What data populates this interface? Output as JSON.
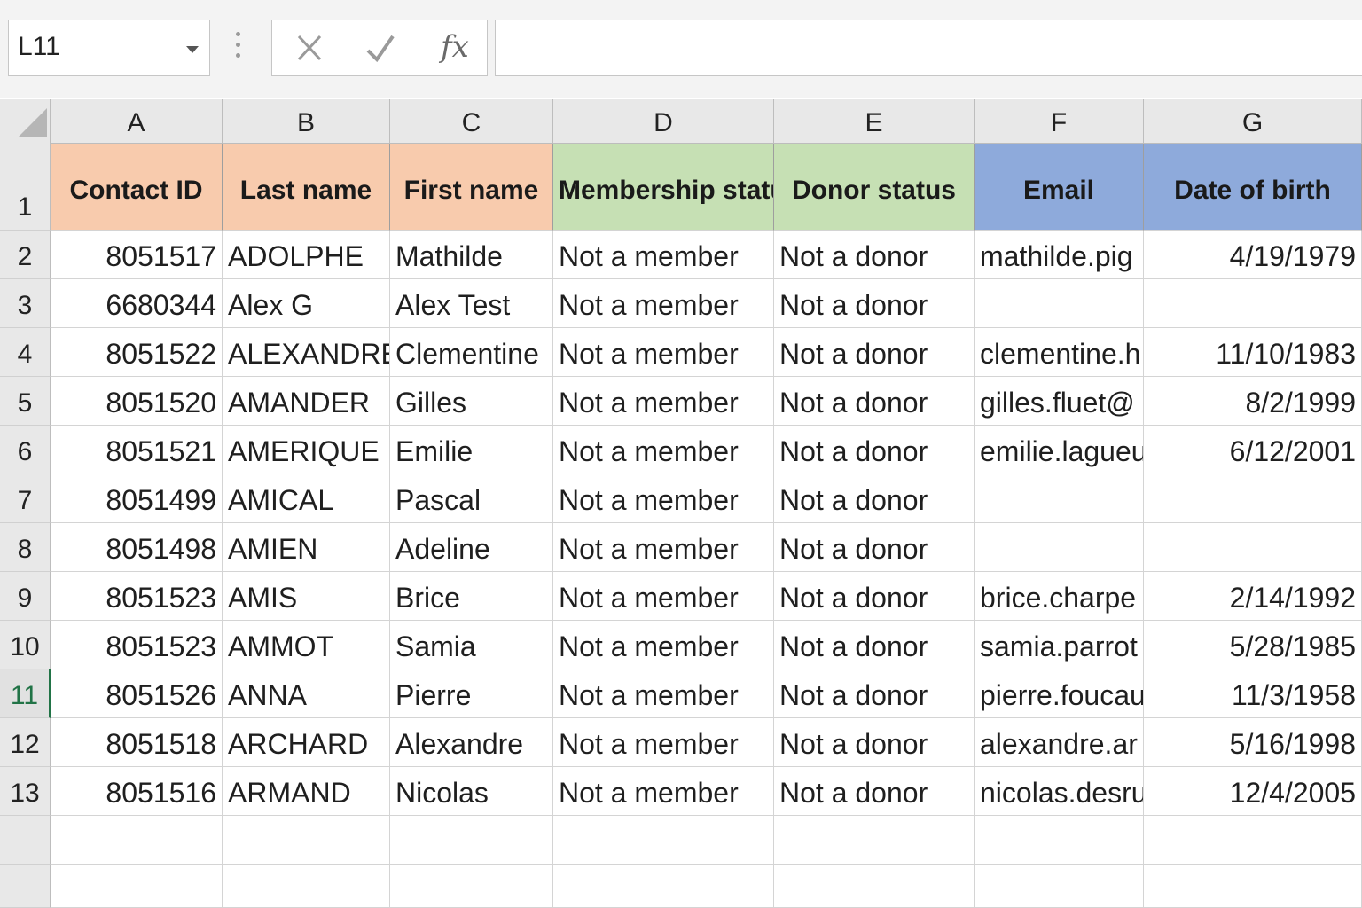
{
  "toolbar": {
    "name_box": "L11",
    "cancel_icon": "close-icon",
    "enter_icon": "check-icon",
    "fx_label": "fx",
    "formula_value": ""
  },
  "colors": {
    "orange_header": "#f8cbad",
    "green_header": "#c6e0b4",
    "blue_header": "#8eaadb",
    "active_row_text": "#217346"
  },
  "sheet": {
    "column_letters": [
      "A",
      "B",
      "C",
      "D",
      "E",
      "F",
      "G"
    ],
    "row_numbers": [
      "1",
      "2",
      "3",
      "4",
      "5",
      "6",
      "7",
      "8",
      "9",
      "10",
      "11",
      "12",
      "13",
      "",
      ""
    ],
    "active_row": "11",
    "headers": [
      "Contact ID",
      "Last name",
      "First name",
      "Membership status",
      "Donor status",
      "Email",
      "Date of birth"
    ],
    "rows": [
      [
        "8051517",
        "ADOLPHE",
        "Mathilde",
        "Not a member",
        "Not a donor",
        "mathilde.pig",
        "4/19/1979"
      ],
      [
        "6680344",
        "Alex G",
        "Alex Test",
        "Not a member",
        "Not a donor",
        "",
        ""
      ],
      [
        "8051522",
        "ALEXANDRE",
        "Clementine",
        "Not a member",
        "Not a donor",
        "clementine.h",
        "11/10/1983"
      ],
      [
        "8051520",
        "AMANDER",
        "Gilles",
        "Not a member",
        "Not a donor",
        "gilles.fluet@",
        "8/2/1999"
      ],
      [
        "8051521",
        "AMERIQUE",
        "Emilie",
        "Not a member",
        "Not a donor",
        "emilie.lagueu",
        "6/12/2001"
      ],
      [
        "8051499",
        "AMICAL",
        "Pascal",
        "Not a member",
        "Not a donor",
        "",
        ""
      ],
      [
        "8051498",
        "AMIEN",
        "Adeline",
        "Not a member",
        "Not a donor",
        "",
        ""
      ],
      [
        "8051523",
        "AMIS",
        "Brice",
        "Not a member",
        "Not a donor",
        "brice.charpe",
        "2/14/1992"
      ],
      [
        "8051523",
        "AMMOT",
        "Samia",
        "Not a member",
        "Not a donor",
        "samia.parrot",
        "5/28/1985"
      ],
      [
        "8051526",
        "ANNA",
        "Pierre",
        "Not a member",
        "Not a donor",
        "pierre.foucau",
        "11/3/1958"
      ],
      [
        "8051518",
        "ARCHARD",
        "Alexandre",
        "Not a member",
        "Not a donor",
        "alexandre.ar",
        "5/16/1998"
      ],
      [
        "8051516",
        "ARMAND",
        "Nicolas",
        "Not a member",
        "Not a donor",
        "nicolas.desru",
        "12/4/2005"
      ]
    ]
  }
}
